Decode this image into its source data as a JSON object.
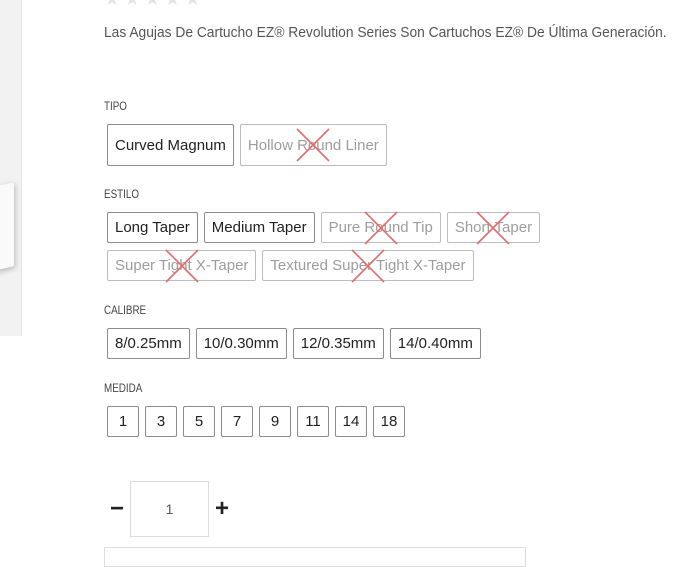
{
  "description": "Las Agujas De Cartucho EZ® Revolution Series Son Cartuchos EZ® De Última Generación.",
  "groups": {
    "tipo": {
      "label": "TIPO",
      "options": [
        {
          "label": "Curved Magnum",
          "available": true
        },
        {
          "label": "Hollow Round Liner",
          "available": false
        }
      ]
    },
    "estilo": {
      "label": "ESTILO",
      "options": [
        {
          "label": "Long Taper",
          "available": true
        },
        {
          "label": "Medium Taper",
          "available": true
        },
        {
          "label": "Pure Round Tip",
          "available": false
        },
        {
          "label": "Short Taper",
          "available": false
        },
        {
          "label": "Super Tight X-Taper",
          "available": false
        },
        {
          "label": "Textured Super Tight X-Taper",
          "available": false
        }
      ]
    },
    "calibre": {
      "label": "CALIBRE",
      "options": [
        {
          "label": "8/0.25mm",
          "available": true
        },
        {
          "label": "10/0.30mm",
          "available": true
        },
        {
          "label": "12/0.35mm",
          "available": true
        },
        {
          "label": "14/0.40mm",
          "available": true
        }
      ]
    },
    "medida": {
      "label": "MEDIDA",
      "options": [
        {
          "label": "1",
          "available": true
        },
        {
          "label": "3",
          "available": true
        },
        {
          "label": "5",
          "available": true
        },
        {
          "label": "7",
          "available": true
        },
        {
          "label": "9",
          "available": true
        },
        {
          "label": "11",
          "available": true
        },
        {
          "label": "14",
          "available": true
        },
        {
          "label": "18",
          "available": true
        }
      ]
    }
  },
  "quantity": {
    "minus_symbol": "−",
    "plus_symbol": "+",
    "value": "1"
  },
  "colors": {
    "unavailable_cross": "#e66a6a",
    "star_empty": "#e3e3e3"
  }
}
